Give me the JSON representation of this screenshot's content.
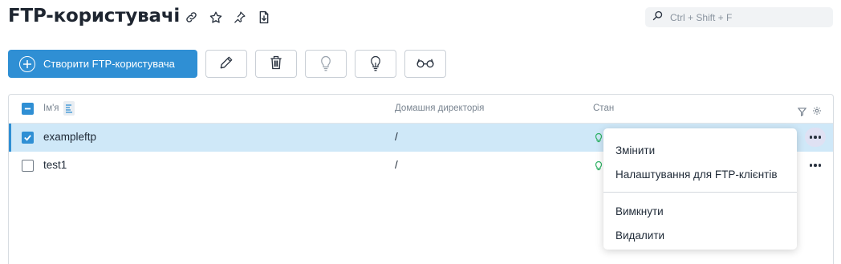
{
  "header": {
    "title": "FTP-користувачі",
    "icons": [
      "link-icon",
      "star-icon",
      "pin-icon",
      "download-file-icon"
    ]
  },
  "search": {
    "placeholder": "Ctrl + Shift + F"
  },
  "toolbar": {
    "create_label": "Створити FTP-користувача",
    "tools": [
      "edit-icon",
      "delete-icon",
      "bulb-off-icon",
      "bulb-on-icon",
      "glasses-icon"
    ]
  },
  "table": {
    "columns": {
      "name": "Ім'я",
      "home_dir": "Домашня директорія",
      "status": "Стан"
    },
    "rows": [
      {
        "name": "exampleftp",
        "home_dir": "/",
        "selected": true
      },
      {
        "name": "test1",
        "home_dir": "/",
        "selected": false
      }
    ]
  },
  "context_menu": {
    "items": [
      "Змінити",
      "Налаштування для FTP-клієнтів",
      "Вимкнути",
      "Видалити"
    ]
  },
  "colors": {
    "accent": "#2f8fd4",
    "selected_row": "#cfe8f8",
    "status_on": "#2fb366"
  }
}
